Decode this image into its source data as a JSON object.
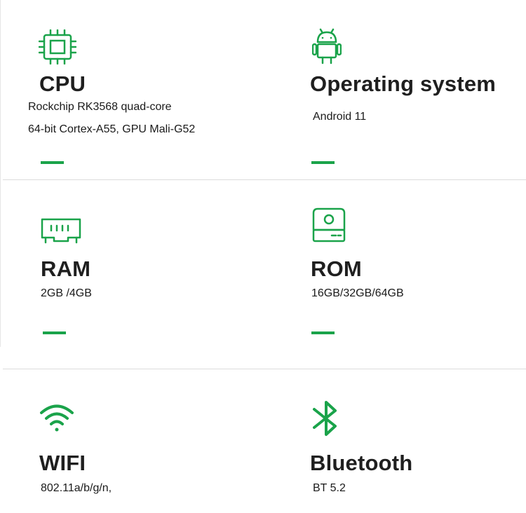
{
  "colors": {
    "accent": "#1aa34a",
    "divider": "#dcdcdc"
  },
  "specs": {
    "cpu": {
      "icon": "cpu-chip-icon",
      "title": "CPU",
      "lines": [
        "Rockchip RK3568 quad-core",
        "64-bit Cortex-A55, GPU Mali-G52"
      ]
    },
    "os": {
      "icon": "android-icon",
      "title": "Operating system",
      "lines": [
        "Android 11"
      ]
    },
    "ram": {
      "icon": "ram-module-icon",
      "title": "RAM",
      "lines": [
        "2GB /4GB"
      ]
    },
    "rom": {
      "icon": "hard-drive-icon",
      "title": "ROM",
      "lines": [
        "16GB/32GB/64GB"
      ]
    },
    "wifi": {
      "icon": "wifi-icon",
      "title": "WIFI",
      "lines": [
        "802.11a/b/g/n,"
      ]
    },
    "bluetooth": {
      "icon": "bluetooth-icon",
      "title": "Bluetooth",
      "lines": [
        "BT 5.2"
      ]
    }
  }
}
